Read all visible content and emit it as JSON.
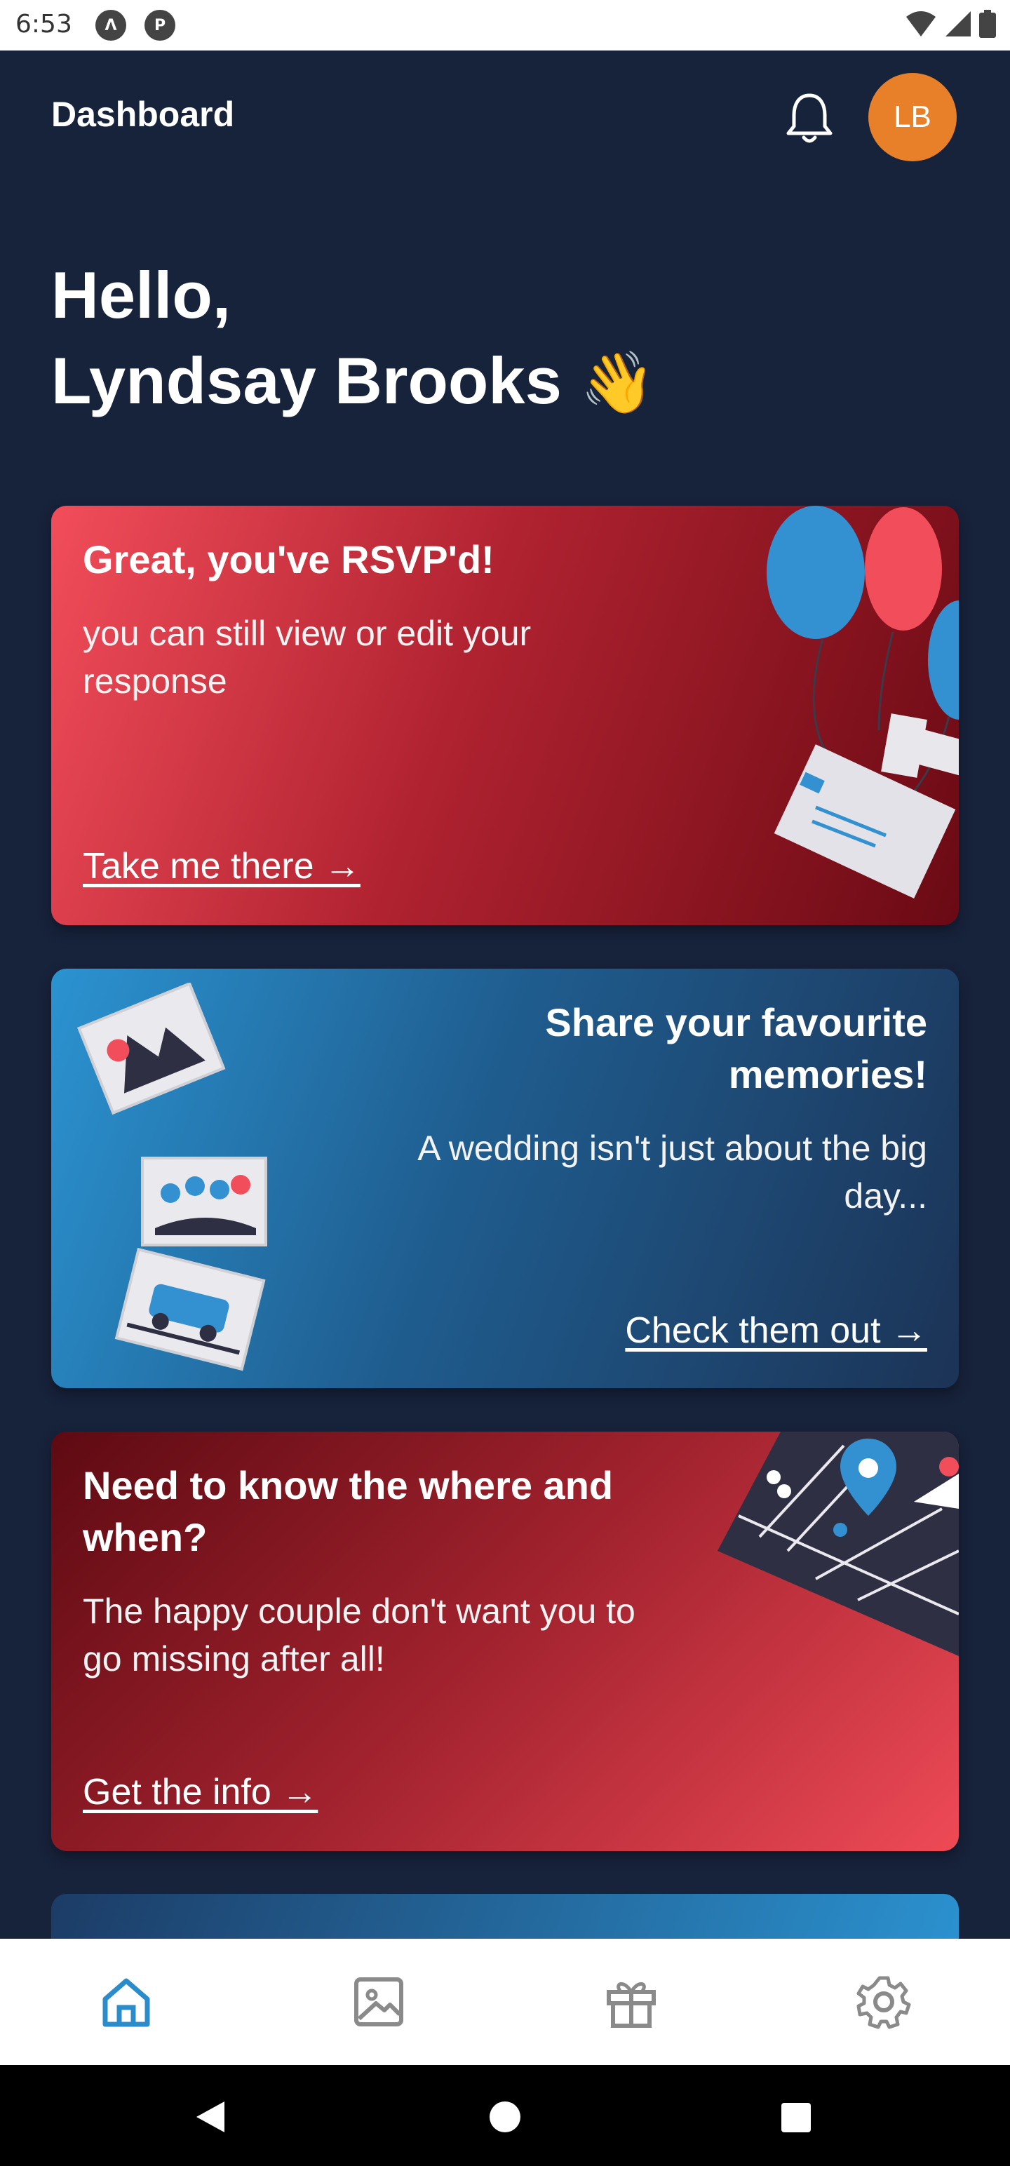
{
  "status_bar": {
    "time": "6:53"
  },
  "header": {
    "title": "Dashboard",
    "avatar_initials": "LB"
  },
  "greeting": {
    "line1": "Hello,",
    "line2": "Lyndsay Brooks",
    "emoji": "👋"
  },
  "cards": {
    "rsvp": {
      "title": "Great, you've RSVP'd!",
      "subtitle_l1": "you can still view or edit your",
      "subtitle_l2": "response",
      "link": "Take me there →"
    },
    "memories": {
      "title_l1": "Share your favourite",
      "title_l2": "memories!",
      "subtitle_l1": "A wedding isn't just about the big",
      "subtitle_l2": "day...",
      "link": "Check them out →"
    },
    "info": {
      "title_l1": "Need to know the where and",
      "title_l2": "when?",
      "subtitle_l1": "The happy couple don't want you to",
      "subtitle_l2": "go missing after all!",
      "link": "Get the info →"
    }
  },
  "bottom_nav": {
    "items": [
      {
        "icon": "home-icon",
        "active": true
      },
      {
        "icon": "image-icon",
        "active": false
      },
      {
        "icon": "gift-icon",
        "active": false
      },
      {
        "icon": "gear-icon",
        "active": false
      }
    ],
    "active_color": "#2b8ccc",
    "inactive_color": "#8a8a8a"
  },
  "colors": {
    "background": "#17223b",
    "avatar": "#e8802a"
  }
}
